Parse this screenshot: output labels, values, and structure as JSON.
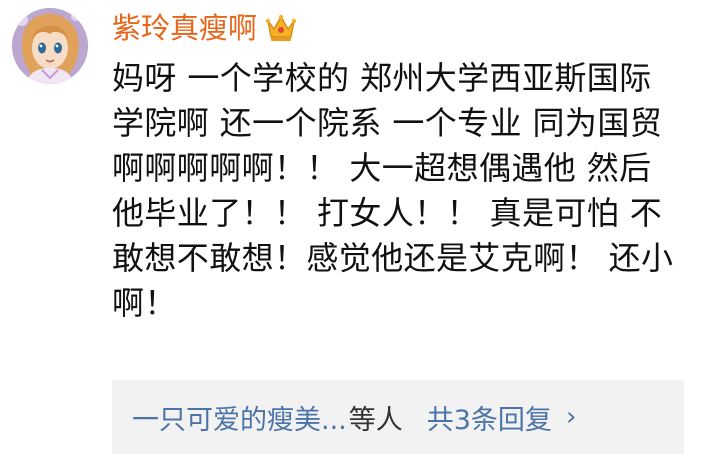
{
  "comment": {
    "username": "紫玲真瘦啊",
    "badge_icon": "crown-icon",
    "text": "妈呀 一个学校的 郑州大学西亚斯国际学院啊 还一个院系 一个专业 同为国贸 啊啊啊啊啊！！ 大一超想偶遇他 然后他毕业了！！ 打女人！！ 真是可怕 不敢想不敢想！感觉他还是艾克啊！ 还小啊！",
    "colors": {
      "username": "#e8661a",
      "link": "#4d74a8",
      "text": "#111111",
      "reply_bg": "#f2f2f2"
    }
  },
  "replies": {
    "names": "一只可爱的瘦美...",
    "suffix": "等人",
    "count_label": "共3条回复",
    "chevron_icon": "chevron-right-icon"
  }
}
